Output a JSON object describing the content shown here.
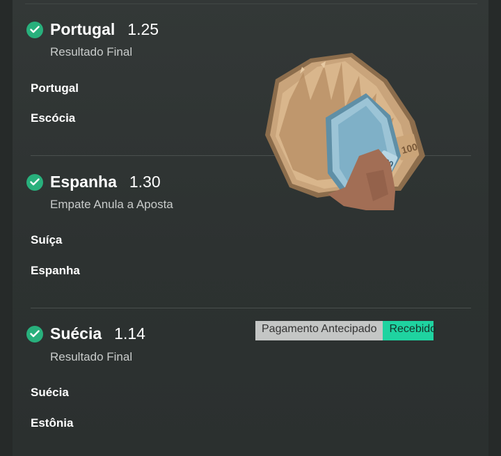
{
  "selections": [
    {
      "team": "Portugal",
      "odd": "1.25",
      "market": "Resultado Final",
      "participants": [
        "Portugal",
        "Escócia"
      ]
    },
    {
      "team": "Espanha",
      "odd": "1.30",
      "market": "Empate Anula a Aposta",
      "participants": [
        "Suíça",
        "Espanha"
      ]
    },
    {
      "team": "Suécia",
      "odd": "1.14",
      "market": "Resultado Final",
      "participants": [
        "Suécia",
        "Estônia"
      ]
    }
  ],
  "badge": {
    "label": "Pagamento Antecipado",
    "status": "Recebido"
  },
  "money_image": {
    "banknote_value": "100"
  },
  "colors": {
    "background": "#2b302f",
    "check": "#28b07c",
    "status_green": "#1fd3a0"
  },
  "icons": {
    "selection_status": "check-circle-icon"
  }
}
